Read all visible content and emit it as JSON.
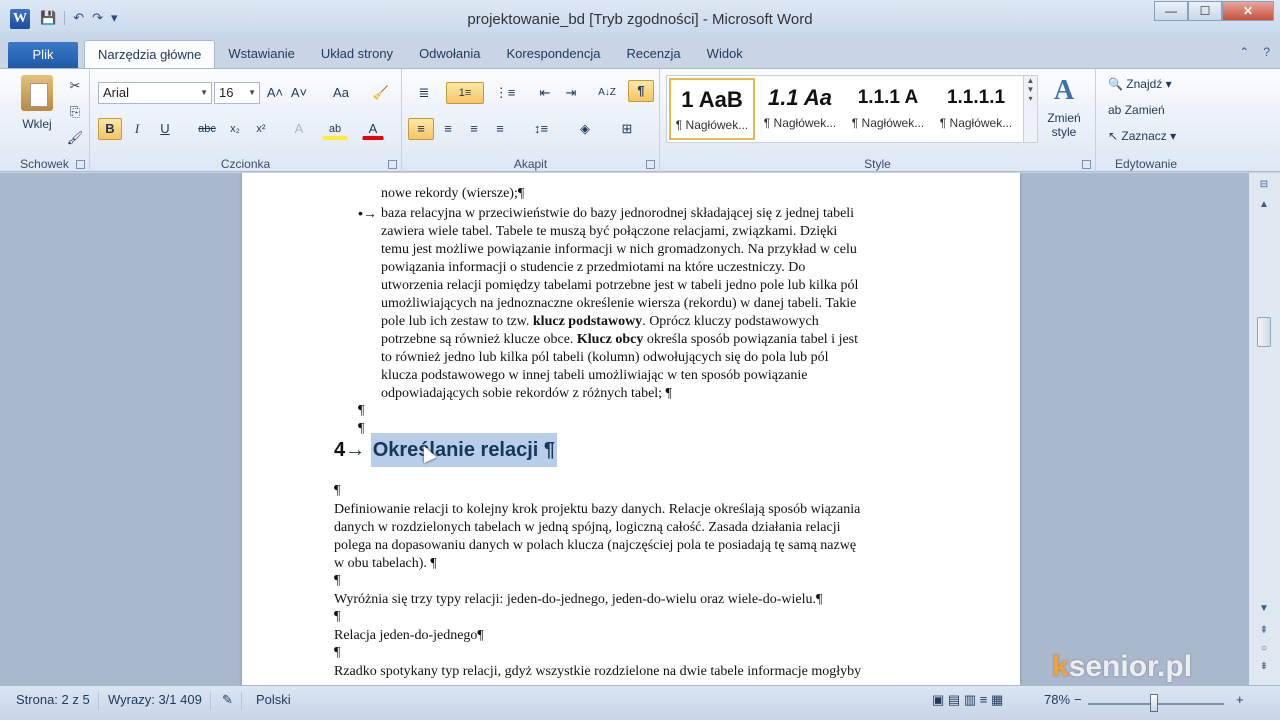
{
  "window": {
    "title": "projektowanie_bd [Tryb zgodności] - Microsoft Word",
    "app_icon_letter": "W",
    "controls": {
      "minimize": "—",
      "maximize": "☐",
      "close": "✕"
    }
  },
  "quick_access": {
    "save": "💾",
    "undo": "↶",
    "redo": "↷",
    "customize": "▾"
  },
  "tabs": {
    "file": "Plik",
    "items": [
      "Narzędzia główne",
      "Wstawianie",
      "Układ strony",
      "Odwołania",
      "Korespondencja",
      "Recenzja",
      "Widok"
    ],
    "active": "Narzędzia główne",
    "help": "?",
    "minimize_ribbon": "⌃"
  },
  "ribbon": {
    "clipboard": {
      "paste_label": "Wklej",
      "group_label": "Schowek",
      "cut": "✂",
      "copy": "⎘",
      "format_painter": "🖌"
    },
    "font": {
      "group_label": "Czcionka",
      "font_name": "Arial",
      "font_size": "16",
      "grow": "A˄",
      "shrink": "A˅",
      "case": "Aa",
      "clear": "🧹",
      "bold": "B",
      "italic": "I",
      "underline": "U",
      "strike": "abc",
      "subscript": "x₂",
      "superscript": "x²",
      "effects": "A",
      "highlight": "ab",
      "font_color": "A"
    },
    "paragraph": {
      "group_label": "Akapit",
      "bullets": "≣",
      "numbering": "1≡",
      "multilevel": "⋮≡",
      "decrease_indent": "⇤",
      "increase_indent": "⇥",
      "sort": "A↓Z",
      "show_marks": "¶",
      "align_left": "≡",
      "center": "≡",
      "align_right": "≡",
      "justify": "≡",
      "line_spacing": "↕≡",
      "shading": "◈",
      "borders": "⊞"
    },
    "styles": {
      "group_label": "Style",
      "items": [
        {
          "preview": "1 AaB",
          "name": "¶ Nagłówek..."
        },
        {
          "preview": "1.1 Aa",
          "name": "¶ Nagłówek..."
        },
        {
          "preview": "1.1.1 A",
          "name": "¶ Nagłówek..."
        },
        {
          "preview": "1.1.1.1",
          "name": "¶ Nagłówek..."
        }
      ],
      "change_styles": "Zmień style"
    },
    "editing": {
      "group_label": "Edytowanie",
      "find": "Znajdź",
      "replace": "Zamień",
      "select": "Zaznacz"
    }
  },
  "document": {
    "top_partial": "nowe rekordy (wiersze);¶",
    "bullet_lines": [
      "baza relacyjna w przeciwieństwie do bazy jednorodnej składającej się z jednej tabeli",
      "zawiera wiele tabel. Tabele te muszą być połączone relacjami, związkami. Dzięki",
      "temu jest możliwe powiązanie informacji w nich gromadzonych. Na przykład w celu",
      "powiązania informacji o studencie z przedmiotami na które uczestniczy. Do",
      "utworzenia relacji pomiędzy tabelami potrzebne jest w tabeli jedno pole lub kilka pól",
      "umożliwiających na jednoznaczne określenie wiersza (rekordu) w danej tabeli. Takie"
    ],
    "line_key_pre": "pole lub ich zestaw to tzw.",
    "key_primary": "klucz podstawowy",
    "line_key_post": ". Oprócz kluczy podstawowych",
    "line_fk_pre": "potrzebne są również klucze obce.",
    "key_foreign": "Klucz obcy",
    "line_fk_post": "określa sposób powiązania tabel i jest",
    "bullet_tail": [
      "to również jedno lub kilka pól tabeli (kolumn) odwołujących się do pola lub pól",
      "klucza podstawowego w innej tabeli umożliwiając w ten sposób powiązanie",
      "odpowiadających sobie rekordów z różnych tabel; ¶"
    ],
    "heading_number": "4",
    "heading_text": "Określanie relacji ¶",
    "para1": [
      "Definiowanie relacji to kolejny krok projektu bazy danych. Relacje określają sposób wiązania",
      "danych w rozdzielonych tabelach w jedną spójną, logiczną całość. Zasada działania relacji",
      "polega na dopasowaniu danych w polach klucza (najczęściej pola te posiadają tę samą nazwę",
      "w obu tabelach). ¶"
    ],
    "para2": "Wyróżnia się trzy typy relacji: jeden-do-jednego, jeden-do-wielu oraz wiele-do-wielu.¶",
    "para3": "Relacja jeden-do-jednego¶",
    "para4": "Rzadko spotykany typ relacji, gdyż wszystkie rozdzielone na dwie tabele informacje mogłyby",
    "pilcrow": "¶"
  },
  "statusbar": {
    "page": "Strona: 2 z 5",
    "words": "Wyrazy: 3/1 409",
    "language": "Polski",
    "zoom": "78%",
    "zoom_out": "−",
    "zoom_in": "+",
    "zoom_level": 0.78
  },
  "watermark": {
    "k": "k",
    "rest": "senior.pl"
  }
}
